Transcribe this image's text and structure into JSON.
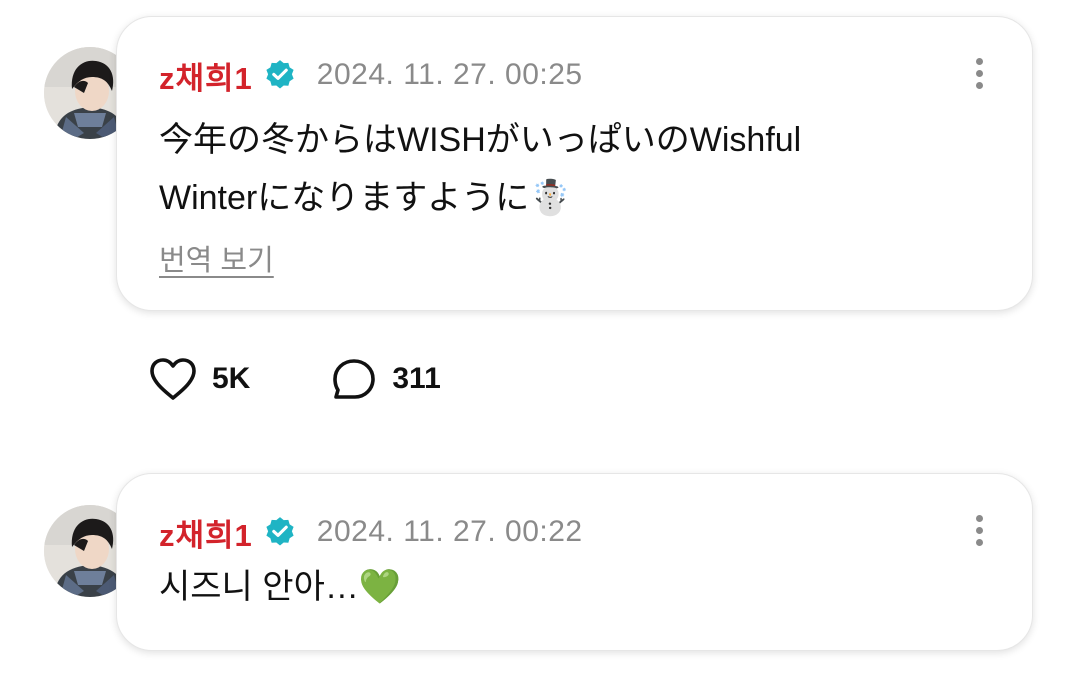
{
  "posts": [
    {
      "author": "ᴢ채희1",
      "timestamp": "2024. 11. 27. 00:25",
      "content": "今年の冬からはWISHがいっぱいのWishful\nWinterになりますように☃️",
      "translate_label": "번역 보기",
      "likes": "5K",
      "comments": "311"
    },
    {
      "author": "ᴢ채희1",
      "timestamp": "2024. 11. 27. 00:22",
      "content": "시즈니 안아…💚"
    }
  ],
  "icons": {
    "verified": "verified-badge-icon",
    "more": "more-vertical-icon",
    "like": "heart-icon",
    "comment": "comment-bubble-icon"
  },
  "colors": {
    "author": "#d3232b",
    "verified": "#1fb4c4",
    "muted": "#8a8a8a"
  }
}
